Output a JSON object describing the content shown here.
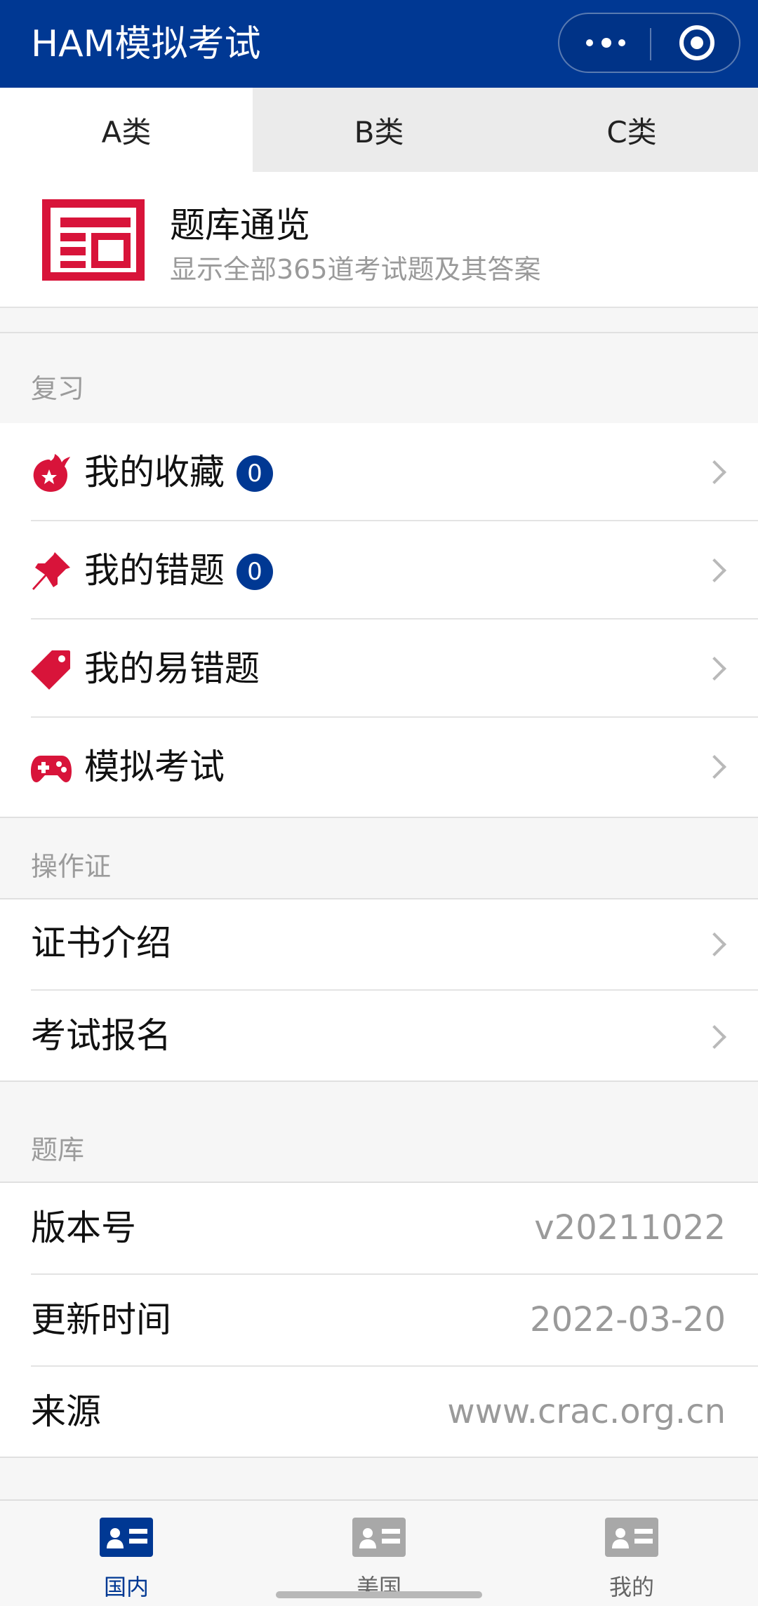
{
  "header": {
    "title": "HAM模拟考试"
  },
  "tabs": [
    {
      "label": "A类",
      "active": true
    },
    {
      "label": "B类",
      "active": false
    },
    {
      "label": "C类",
      "active": false
    }
  ],
  "overview": {
    "title": "题库通览",
    "subtitle": "显示全部365道考试题及其答案",
    "icon": "question-bank-icon"
  },
  "review": {
    "section_label": "复习",
    "items": [
      {
        "label": "我的收藏",
        "badge": "0",
        "icon": "fire-star-icon"
      },
      {
        "label": "我的错题",
        "badge": "0",
        "icon": "pin-icon"
      },
      {
        "label": "我的易错题",
        "icon": "tag-icon"
      },
      {
        "label": "模拟考试",
        "icon": "gamepad-icon"
      }
    ]
  },
  "license": {
    "section_label": "操作证",
    "items": [
      {
        "label": "证书介绍"
      },
      {
        "label": "考试报名"
      }
    ]
  },
  "bank": {
    "section_label": "题库",
    "rows": [
      {
        "label": "版本号",
        "value": "v20211022"
      },
      {
        "label": "更新时间",
        "value": "2022-03-20"
      },
      {
        "label": "来源",
        "value": "www.crac.org.cn"
      }
    ]
  },
  "bottom_nav": [
    {
      "label": "国内",
      "active": true,
      "icon": "id-card-icon"
    },
    {
      "label": "美国",
      "active": false,
      "icon": "id-card-icon"
    },
    {
      "label": "我的",
      "active": false,
      "icon": "id-card-icon"
    }
  ],
  "colors": {
    "brand": "#003893",
    "accent_red": "#d8143a",
    "inactive_nav": "#a8a8a8"
  }
}
